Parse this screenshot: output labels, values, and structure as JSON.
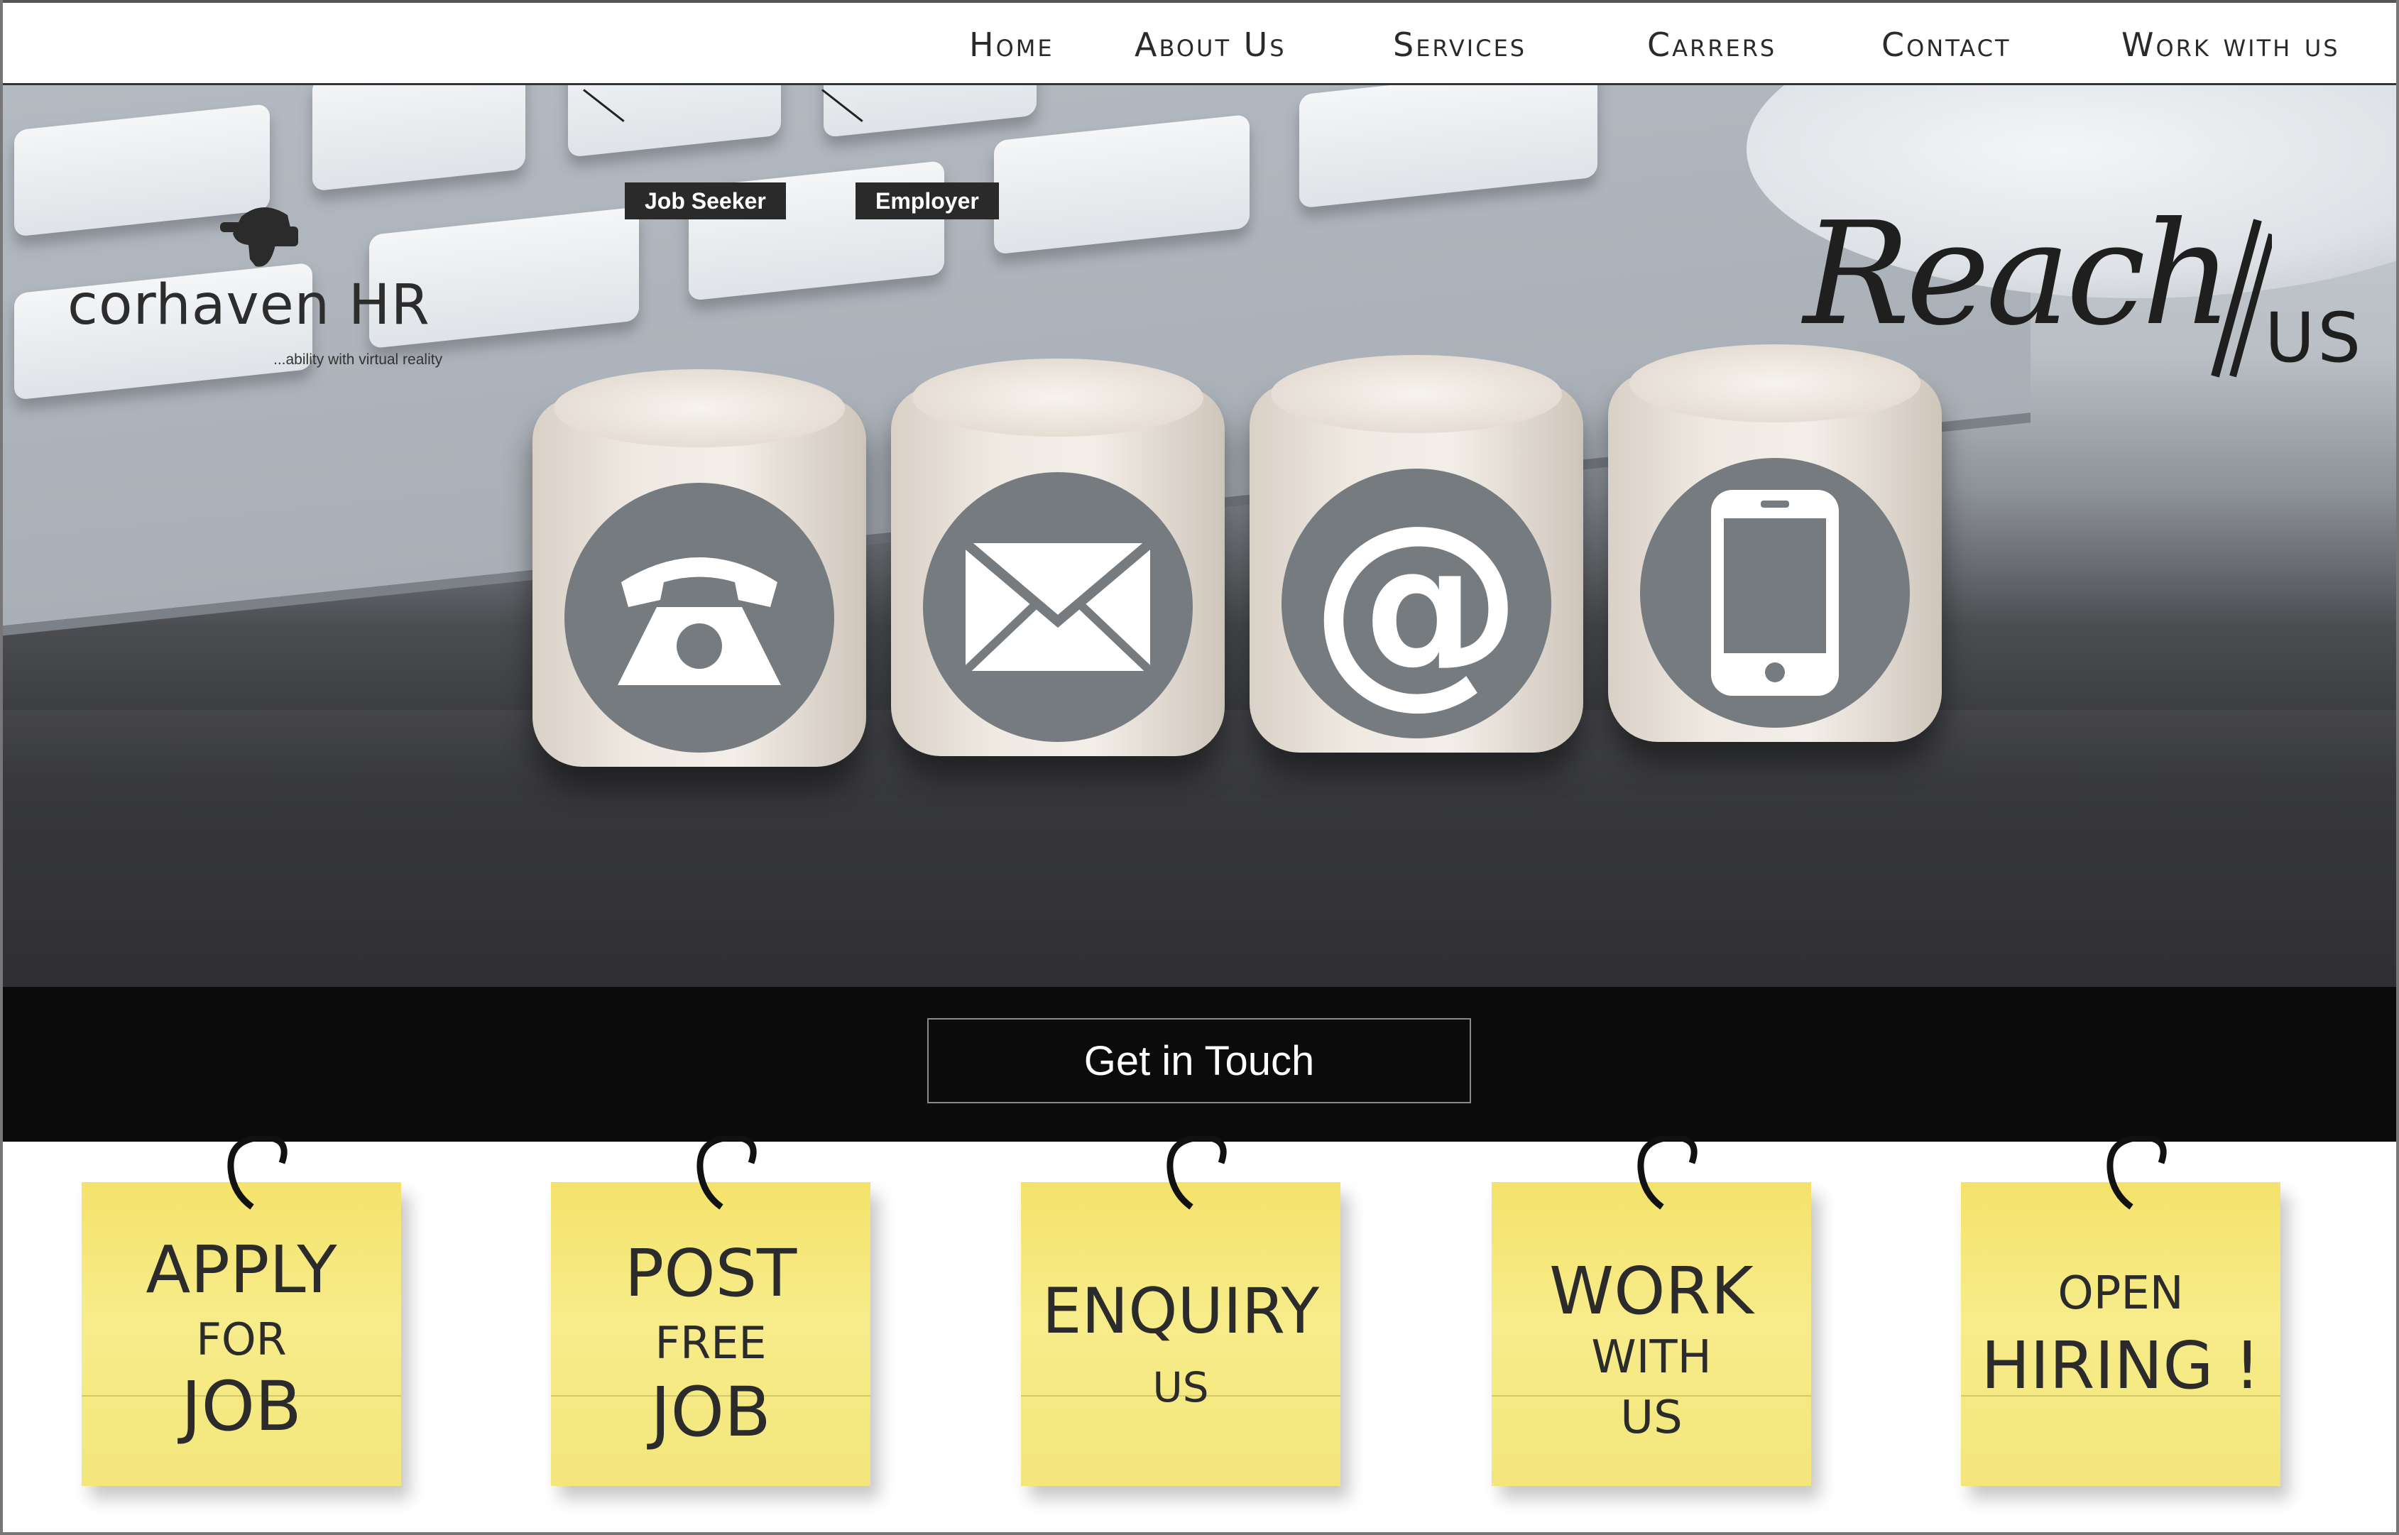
{
  "nav": {
    "items": [
      "Home",
      "About Us",
      "Services",
      "Carrers",
      "Contact",
      "Work with us"
    ]
  },
  "hero": {
    "logo": {
      "name": "corhaven HR",
      "tagline": "...ability with virtual reality"
    },
    "tags": {
      "job_seeker": "Job Seeker",
      "employer": "Employer"
    },
    "reach": {
      "script": "Reach",
      "us": "US"
    },
    "cubes": [
      "phone-icon",
      "envelope-icon",
      "at-sign-icon",
      "mobile-phone-icon"
    ]
  },
  "cta": {
    "label": "Get in Touch"
  },
  "notes": [
    {
      "lines": [
        "APPLY",
        "FOR",
        "JOB"
      ]
    },
    {
      "lines": [
        "POST",
        "FREE",
        "JOB"
      ]
    },
    {
      "lines": [
        "ENQUIRY",
        "US"
      ]
    },
    {
      "lines": [
        "WORK",
        "WITH",
        "US"
      ]
    },
    {
      "lines": [
        "OPEN",
        "HIRING !"
      ]
    }
  ],
  "colors": {
    "note": "#f4e26a",
    "band": "#0b0b0b",
    "icon_circle": "#767b80"
  }
}
